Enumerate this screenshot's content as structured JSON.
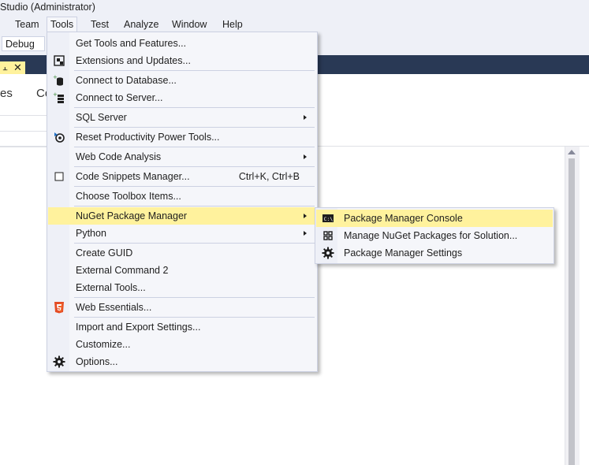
{
  "window": {
    "title": "Studio  (Administrator)"
  },
  "menubar": {
    "items": [
      "Team",
      "Tools",
      "Test",
      "Analyze",
      "Window",
      "Help"
    ]
  },
  "toolbar": {
    "config_value": "Debug"
  },
  "panel": {
    "tab_left": "es",
    "tab_right": "Co"
  },
  "tools_menu": {
    "items": [
      {
        "label": "Get Tools and Features...",
        "icon": "tools-features-icon"
      },
      {
        "label": "Extensions and Updates...",
        "icon": "extensions-icon"
      },
      {
        "label": "Connect to Database...",
        "icon": "database-icon"
      },
      {
        "label": "Connect to Server...",
        "icon": "server-icon"
      },
      {
        "label": "SQL Server",
        "submenu": true
      },
      {
        "label": "Reset Productivity Power Tools...",
        "icon": "reset-icon"
      },
      {
        "label": "Web Code Analysis",
        "submenu": true
      },
      {
        "label": "Code Snippets Manager...",
        "shortcut": "Ctrl+K, Ctrl+B",
        "icon": "checkbox-icon"
      },
      {
        "label": "Choose Toolbox Items..."
      },
      {
        "label": "NuGet Package Manager",
        "submenu": true,
        "highlighted": true
      },
      {
        "label": "Python",
        "submenu": true
      },
      {
        "label": "Create GUID"
      },
      {
        "label": "External Command 2"
      },
      {
        "label": "External Tools..."
      },
      {
        "label": "Web Essentials...",
        "icon": "web-essentials-icon"
      },
      {
        "label": "Import and Export Settings..."
      },
      {
        "label": "Customize..."
      },
      {
        "label": "Options...",
        "icon": "gear-icon"
      }
    ]
  },
  "nuget_submenu": {
    "items": [
      {
        "label": "Package Manager Console",
        "icon": "console-icon",
        "highlighted": true
      },
      {
        "label": "Manage NuGet Packages for Solution...",
        "icon": "packages-icon"
      },
      {
        "label": "Package Manager Settings",
        "icon": "gear-icon"
      }
    ]
  },
  "colors": {
    "menu_bg": "#f5f6fa",
    "highlight": "#fff29d",
    "doc_well": "#293955",
    "menu_border": "#ccd1e2"
  }
}
